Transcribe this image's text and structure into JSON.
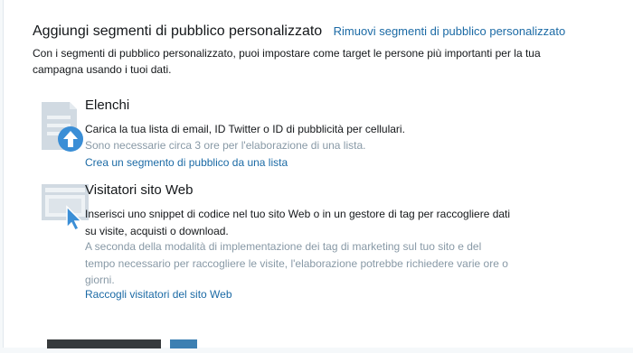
{
  "header": {
    "title": "Aggiungi segmenti di pubblico personalizzato",
    "remove_link": "Rimuovi segmenti di pubblico personalizzato",
    "intro": "Con i segmenti di pubblico personalizzato, puoi impostare come target le persone più importanti per la tua campagna usando i tuoi dati."
  },
  "options": [
    {
      "icon": "upload-list-icon",
      "title": "Elenchi",
      "description": "Carica la tua lista di email, ID Twitter o ID di pubblicità per cellulari.",
      "note": "Sono necessarie circa 3 ore per l'elaborazione di una lista.",
      "action": "Crea un segmento di pubblico da una lista"
    },
    {
      "icon": "website-cursor-icon",
      "title": "Visitatori sito Web",
      "description": "Inserisci uno snippet di codice nel tuo sito Web o in un gestore di tag per raccogliere dati su visite, acquisti o download.",
      "note": "A seconda della modalità di implementazione dei tag di marketing sul tuo sito e del tempo necessario per raccogliere le visite, l'elaborazione potrebbe richiedere varie ore o giorni.",
      "action": "Raccogli visitatori del sito Web"
    }
  ],
  "colors": {
    "link": "#1b6aa5",
    "icon_gray": "#c9d3dc",
    "icon_blue": "#3a8ed6",
    "muted_text": "#8899a6"
  }
}
